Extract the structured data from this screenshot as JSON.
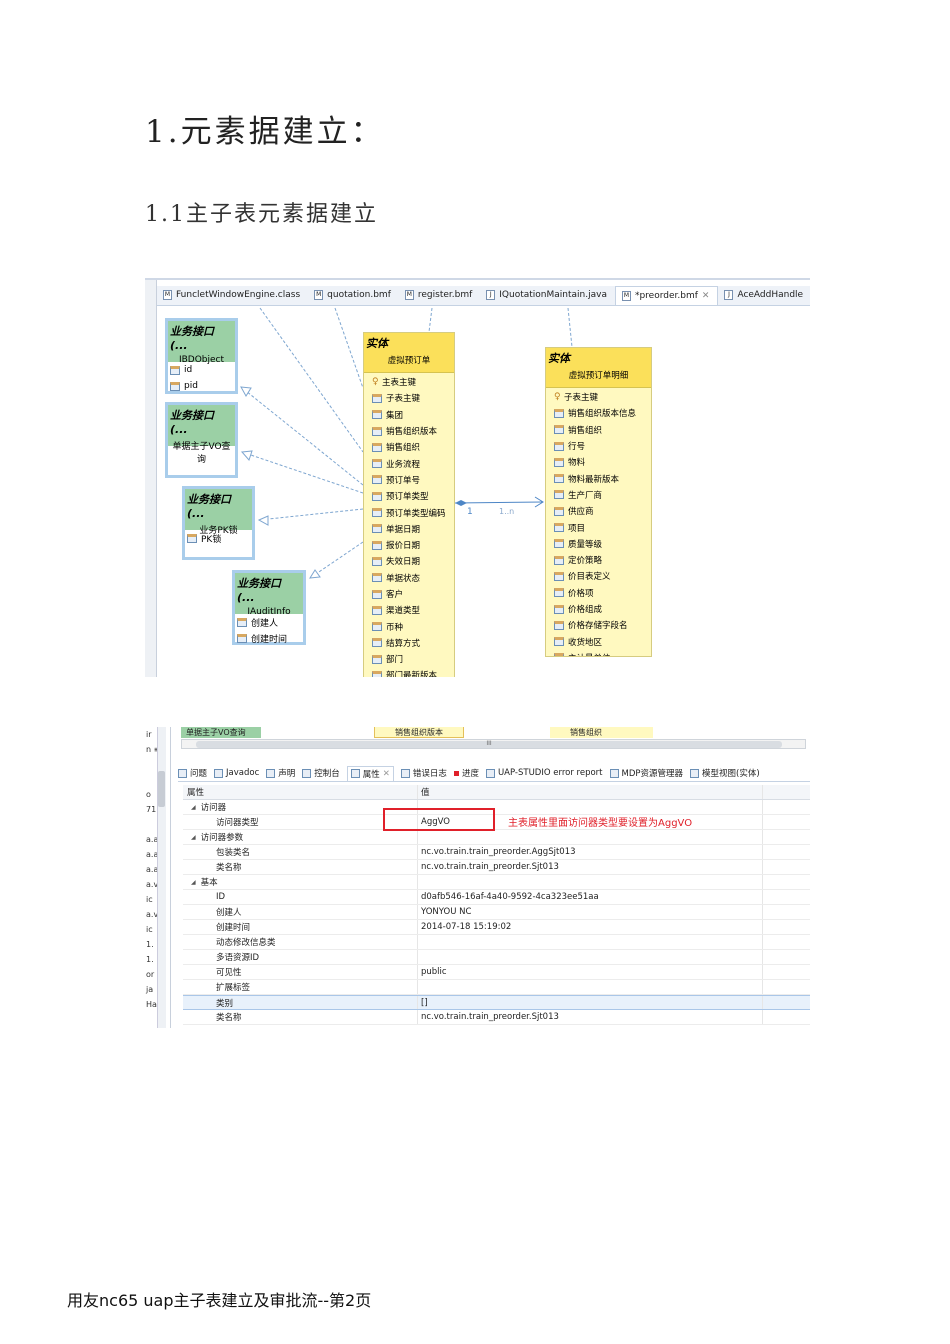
{
  "heading": "1.元素据建立：",
  "subheading": "1.1主子表元素据建立",
  "footer": "用友nc65 uap主子表建立及审批流--第2页",
  "editor_tabs": [
    "FuncletWindowEngine.class",
    "quotation.bmf",
    "register.bmf",
    "IQuotationMaintain.java",
    "*preorder.bmf",
    "AceAddHandle"
  ],
  "interfaces": [
    {
      "stereotype": "业务接口 (...",
      "name": "IBDObject",
      "fields": [
        "id",
        "pid"
      ]
    },
    {
      "stereotype": "业务接口 (...",
      "name": "单据主子VO查询",
      "fields": []
    },
    {
      "stereotype": "业务接口 (...",
      "name": "业务PK锁",
      "fields": [
        "PK锁"
      ]
    },
    {
      "stereotype": "业务接口 (...",
      "name": "IAuditInfo",
      "fields": [
        "创建人",
        "创建时间"
      ]
    }
  ],
  "entities": [
    {
      "stereotype": "实体",
      "name": "虚拟预订单",
      "fields": [
        "主表主键",
        "子表主键",
        "集团",
        "销售组织版本",
        "销售组织",
        "业务流程",
        "预订单号",
        "预订单类型",
        "预订单类型编码",
        "单据日期",
        "报价日期",
        "失效日期",
        "单据状态",
        "客户",
        "渠道类型",
        "币种",
        "结算方式",
        "部门",
        "部门最新版本"
      ]
    },
    {
      "stereotype": "实体",
      "name": "虚拟预订单明细",
      "fields": [
        "子表主键",
        "销售组织版本信息",
        "销售组织",
        "行号",
        "物料",
        "物料最新版本",
        "生产厂商",
        "供应商",
        "项目",
        "质量等级",
        "定价策略",
        "价目表定义",
        "价格项",
        "价格组成",
        "价格存储字段名",
        "收货地区",
        "主计量单位"
      ]
    }
  ],
  "association": {
    "source_mult": "1",
    "target_mult": "1..n"
  },
  "strip": {
    "left": "单据主子VO查询",
    "mid": "销售组织版本",
    "right": "销售组织",
    "scroll_label": "III"
  },
  "left_panel": [
    "ir",
    "n ≡",
    "",
    "",
    "o",
    "71",
    "",
    "a.a",
    "a.a",
    "a.a",
    "a.v",
    "ic",
    "a.v",
    "ic",
    "1.",
    "1.",
    "or",
    "ja",
    "Ha ▾"
  ],
  "view_tabs": [
    "问题",
    "Javadoc",
    "声明",
    "控制台",
    "属性",
    "错误日志",
    "进度",
    "UAP-STUDIO error report",
    "MDP资源管理器",
    "模型视图(实体)"
  ],
  "properties": {
    "headers": [
      "属性",
      "值"
    ],
    "rows": [
      {
        "k": "访问器",
        "v": "",
        "g": true
      },
      {
        "k": "访问器类型",
        "v": "AggVO"
      },
      {
        "k": "访问器参数",
        "v": "",
        "g": true
      },
      {
        "k": "包装类名",
        "v": "nc.vo.train.train_preorder.AggSjt013"
      },
      {
        "k": "类名称",
        "v": "nc.vo.train.train_preorder.Sjt013"
      },
      {
        "k": "基本",
        "v": "",
        "g": true
      },
      {
        "k": "ID",
        "v": "d0afb546-16af-4a40-9592-4ca323ee51aa"
      },
      {
        "k": "创建人",
        "v": "YONYOU NC"
      },
      {
        "k": "创建时间",
        "v": "2014-07-18 15:19:02"
      },
      {
        "k": "动态修改信息类",
        "v": ""
      },
      {
        "k": "多语资源ID",
        "v": ""
      },
      {
        "k": "可见性",
        "v": "public"
      },
      {
        "k": "扩展标签",
        "v": ""
      },
      {
        "k": "类别",
        "v": "[]",
        "sel": true
      },
      {
        "k": "类名称",
        "v": "nc.vo.train.train_preorder.Sjt013"
      }
    ]
  },
  "annotation": "主表属性里面访问器类型要设置为AggVO",
  "colors": {
    "annotation": "#e0202a",
    "interface": "#9bd0a5",
    "entity": "#fbe05a"
  }
}
